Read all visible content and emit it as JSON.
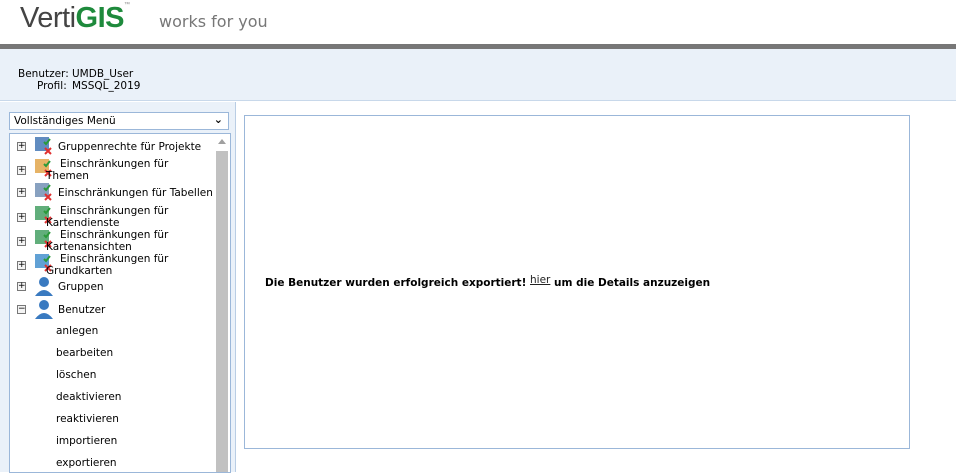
{
  "header": {
    "logo_text_1": "Verti",
    "logo_text_2": "GIS",
    "logo_tm": "™",
    "slogan": "works for you"
  },
  "user_info": {
    "user_label": "Benutzer:",
    "user_value": "UMDB_User",
    "profile_label": "Profil:",
    "profile_value": "MSSQL_2019"
  },
  "sidebar": {
    "menu_select": "Vollständiges Menü",
    "tree": [
      {
        "label": "Gruppenrechte für Projekte",
        "icon": "project-group-rights-icon",
        "expanded": false
      },
      {
        "label": "Einschränkungen für",
        "label2": "Themen",
        "icon": "theme-restrictions-icon",
        "expanded": false
      },
      {
        "label": "Einschränkungen für Tabellen",
        "icon": "table-restrictions-icon",
        "expanded": false
      },
      {
        "label": "Einschränkungen für",
        "label2": "Kartendienste",
        "icon": "map-service-restrictions-icon",
        "expanded": false
      },
      {
        "label": "Einschränkungen für",
        "label2": "Kartenansichten",
        "icon": "map-view-restrictions-icon",
        "expanded": false
      },
      {
        "label": "Einschränkungen für",
        "label2": "Grundkarten",
        "icon": "basemap-restrictions-icon",
        "expanded": false
      },
      {
        "label": "Gruppen",
        "icon": "groups-icon",
        "expanded": false
      },
      {
        "label": "Benutzer",
        "icon": "user-icon",
        "expanded": true
      }
    ],
    "user_actions": [
      "anlegen",
      "bearbeiten",
      "löschen",
      "deaktivieren",
      "reaktivieren",
      "importieren",
      "exportieren"
    ]
  },
  "main": {
    "message_before": "Die Benutzer wurden erfolgreich exportiert! ",
    "link": "hier",
    "message_after": " um die Details anzuzeigen"
  }
}
